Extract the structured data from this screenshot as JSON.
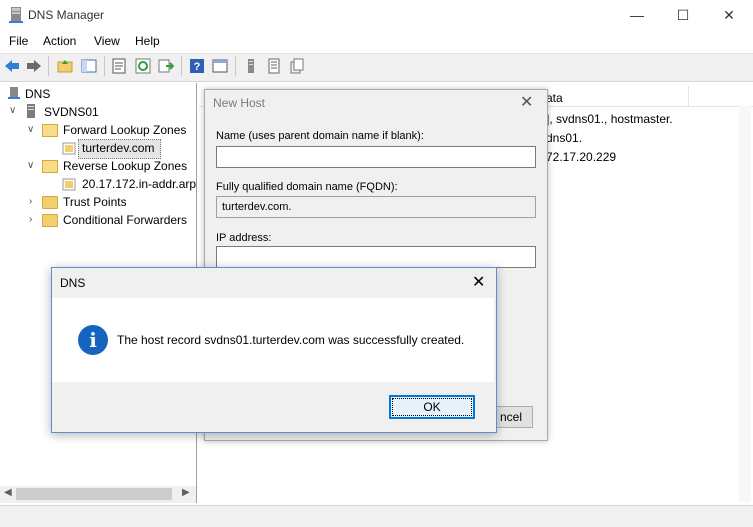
{
  "window": {
    "title": "DNS Manager"
  },
  "menu": [
    "File",
    "Action",
    "View",
    "Help"
  ],
  "tree": {
    "root": "DNS",
    "server": "SVDNS01",
    "forward_zones": "Forward Lookup Zones",
    "forward_zone_item": "turterdev.com",
    "reverse_zones": "Reverse Lookup Zones",
    "reverse_zone_item": "20.17.172.in-addr.arp",
    "trust_points": "Trust Points",
    "conditional_forwarders": "Conditional Forwarders"
  },
  "right_pane": {
    "column_data": "ata",
    "rows": [
      "], svdns01., hostmaster.",
      "dns01.",
      "72.17.20.229"
    ]
  },
  "new_host": {
    "title": "New Host",
    "name_label": "Name (uses parent domain name if blank):",
    "name_value": "",
    "fqdn_label": "Fully qualified domain name (FQDN):",
    "fqdn_value": "turterdev.com.",
    "ip_label": "IP address:",
    "ip_value": "",
    "cancel_partial": "ncel"
  },
  "msgbox": {
    "title": "DNS",
    "message": "The host record svdns01.turterdev.com was successfully created.",
    "ok_label": "OK",
    "icon": "info-icon"
  },
  "colors": {
    "accent": "#0078d7",
    "info_icon": "#1565c0",
    "folder": "#f2cf6b"
  }
}
